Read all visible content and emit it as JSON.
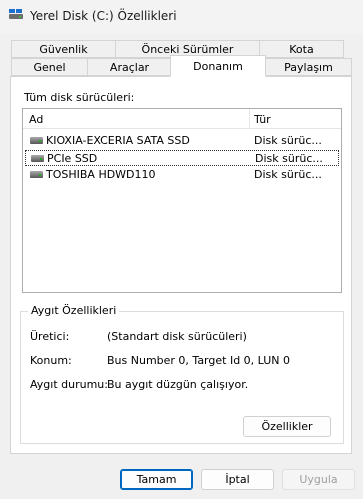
{
  "window": {
    "title": "Yerel Disk (C:) Özellikleri"
  },
  "tabs": {
    "row1": [
      "Güvenlik",
      "Önceki Sürümler",
      "Kota"
    ],
    "row2": [
      "Genel",
      "Araçlar",
      "Donanım",
      "Paylaşım"
    ],
    "active": "Donanım"
  },
  "disks_section": {
    "label": "Tüm disk sürücüleri:",
    "columns": {
      "name": "Ad",
      "type": "Tür"
    },
    "rows": [
      {
        "name": "KIOXIA-EXCERIA SATA SSD",
        "type": "Disk sürüc...",
        "icon": "drive-icon"
      },
      {
        "name": "PCIe SSD",
        "type": "Disk sürüc...",
        "icon": "drive-icon",
        "focused": true
      },
      {
        "name": "TOSHIBA HDWD110",
        "type": "Disk sürüc...",
        "icon": "drive-icon"
      }
    ]
  },
  "device_properties": {
    "title": "Aygıt Özellikleri",
    "manufacturer_label": "Üretici:",
    "manufacturer_value": "(Standart disk sürücüleri)",
    "location_label": "Konum:",
    "location_value": "Bus Number 0, Target Id 0, LUN 0",
    "status_label": "Aygıt durumu:",
    "status_value": "Bu aygıt düzgün çalışıyor.",
    "properties_button": "Özellikler"
  },
  "footer": {
    "ok": "Tamam",
    "cancel": "İptal",
    "apply": "Uygula"
  }
}
